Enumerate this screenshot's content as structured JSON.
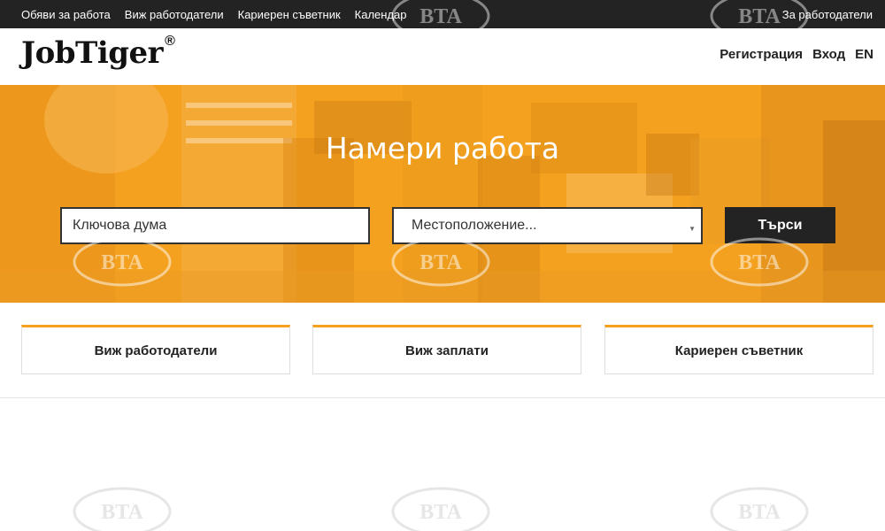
{
  "topbar": {
    "links": [
      "Обяви за работа",
      "Виж работодатели",
      "Кариерен съветник",
      "Календар"
    ],
    "employers_link": "За работодатели"
  },
  "header": {
    "logo": "JobTiger",
    "logo_mark": "®",
    "register": "Регистрация",
    "login": "Вход",
    "language": "EN"
  },
  "hero": {
    "title": "Намери работа",
    "keyword_placeholder": "Ключова дума",
    "location_placeholder": "Местоположение...",
    "search_button": "Търси"
  },
  "cards": [
    "Виж работодатели",
    "Виж заплати",
    "Кариерен съветник"
  ],
  "watermark": "BTA",
  "colors": {
    "accent": "#f4a11f",
    "dark": "#232323"
  }
}
